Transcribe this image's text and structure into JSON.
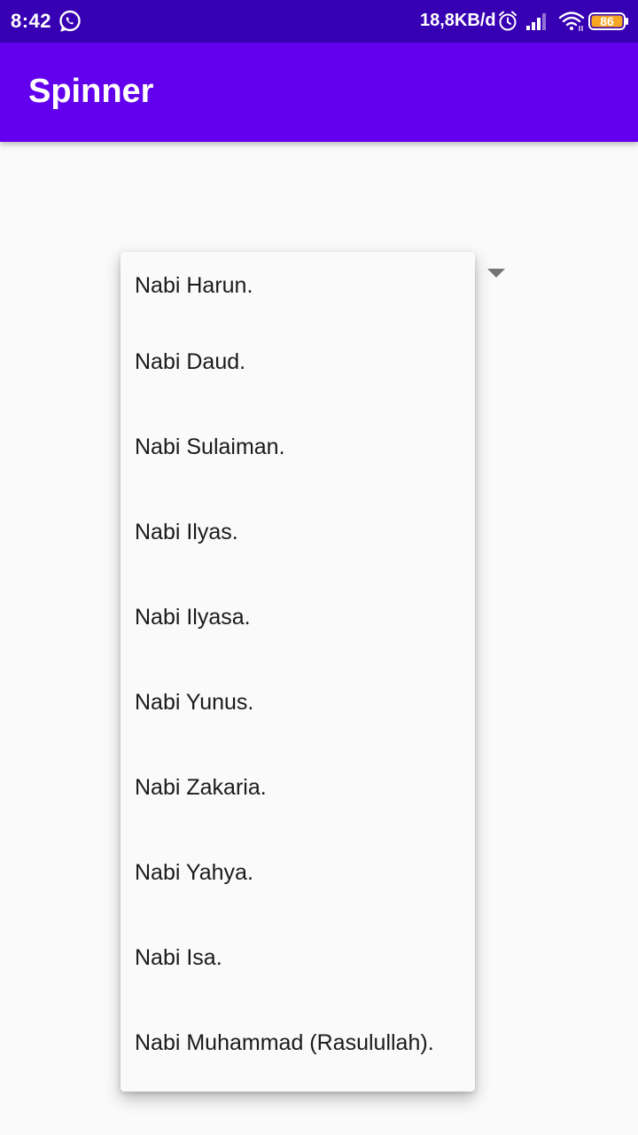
{
  "status_bar": {
    "time": "8:42",
    "network_speed": "18,8KB/d",
    "battery_level": "86",
    "icons": [
      "whatsapp-icon",
      "alarm-icon",
      "signal-icon",
      "wifi-icon",
      "battery-icon"
    ]
  },
  "app_bar": {
    "title": "Spinner"
  },
  "spinner": {
    "items": [
      {
        "label": "Nabi Harun."
      },
      {
        "label": "Nabi Daud."
      },
      {
        "label": "Nabi Sulaiman."
      },
      {
        "label": "Nabi Ilyas."
      },
      {
        "label": "Nabi Ilyasa."
      },
      {
        "label": "Nabi Yunus."
      },
      {
        "label": "Nabi Zakaria."
      },
      {
        "label": "Nabi Yahya."
      },
      {
        "label": "Nabi Isa."
      },
      {
        "label": "Nabi Muhammad (Rasulullah)."
      }
    ]
  },
  "colors": {
    "status_bar": "#3700b3",
    "app_bar": "#6200ee",
    "background": "#fafafa",
    "battery_fill": "#f5a623"
  }
}
